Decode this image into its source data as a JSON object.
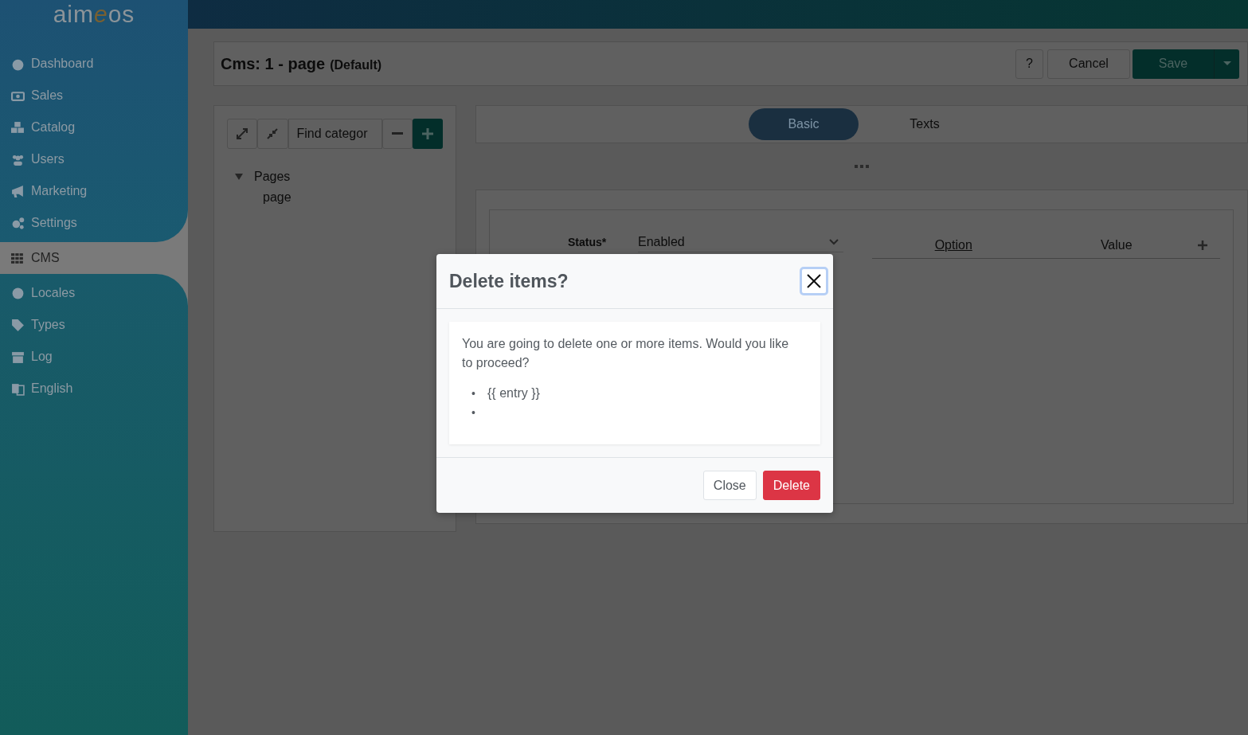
{
  "brand": {
    "logo": [
      {
        "text": "aim",
        "accent": false
      },
      {
        "text": "e",
        "accent": true
      },
      {
        "text": "os",
        "accent": false
      }
    ]
  },
  "sidebar": {
    "items": [
      {
        "label": "Dashboard",
        "selected": false
      },
      {
        "label": "Sales",
        "selected": false
      },
      {
        "label": "Catalog",
        "selected": false
      },
      {
        "label": "Users",
        "selected": false
      },
      {
        "label": "Marketing",
        "selected": false
      },
      {
        "label": "Settings",
        "selected": false
      },
      {
        "label": "CMS",
        "selected": true
      },
      {
        "label": "Locales",
        "selected": false
      },
      {
        "label": "Types",
        "selected": false
      },
      {
        "label": "Log",
        "selected": false
      },
      {
        "label": "English",
        "selected": false
      }
    ]
  },
  "header": {
    "title": "Cms: 1 - page",
    "subtitle": "(Default)",
    "help": "?",
    "cancel": "Cancel",
    "save": "Save"
  },
  "tree": {
    "search": {
      "placeholder": "Find categor"
    },
    "nodes": [
      {
        "label": "Pages",
        "expanded": true,
        "children": [
          {
            "label": "page"
          }
        ]
      }
    ]
  },
  "tabs": [
    {
      "label": "Basic",
      "selected": true
    },
    {
      "label": "Texts",
      "selected": false
    }
  ],
  "form": {
    "status": {
      "label": "Status*",
      "value": "Enabled"
    },
    "columns": [
      "Option",
      "Value"
    ]
  },
  "modal": {
    "title": "Delete items?",
    "message": "You are going to delete one or more items. Would you like to proceed?",
    "items": [
      {
        "kind": "text",
        "marker": "•",
        "text": "{{ entry }}"
      },
      {
        "kind": "empty",
        "marker": "•"
      }
    ],
    "close": "Close",
    "delete": "Delete"
  }
}
